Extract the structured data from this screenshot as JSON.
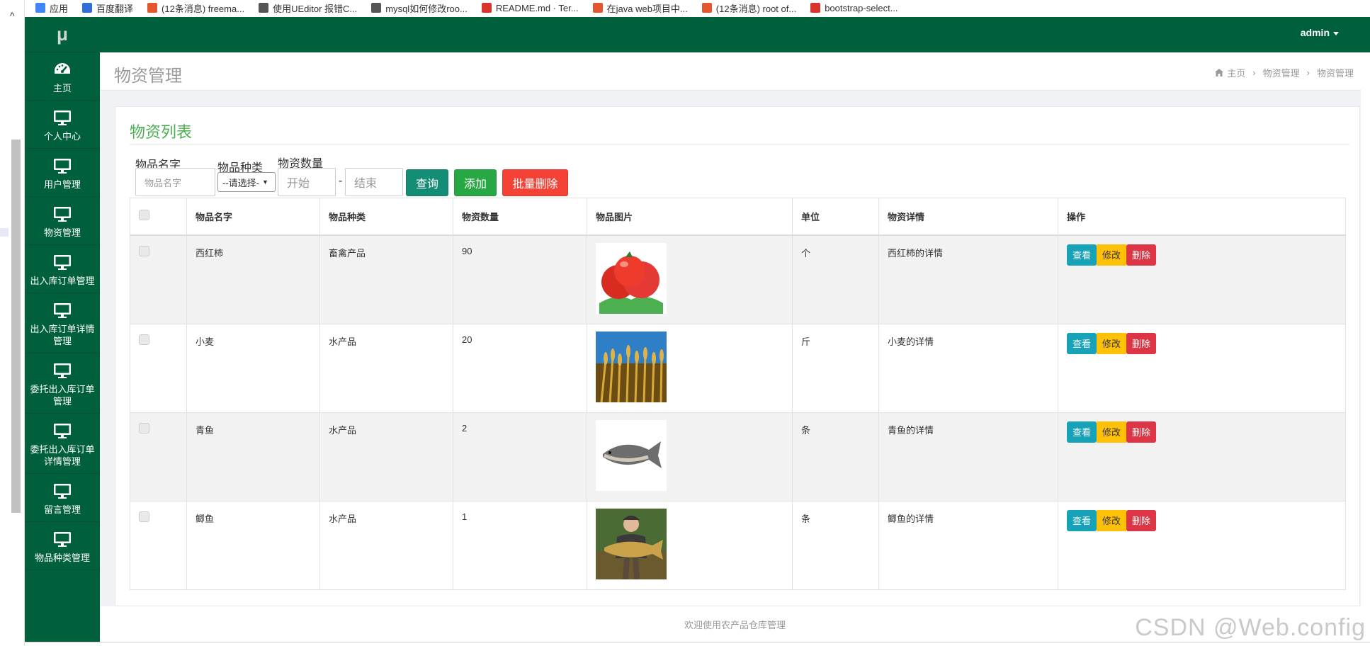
{
  "bookmarks": [
    {
      "label": "应用",
      "color": "#4285f4"
    },
    {
      "label": "百度翻译",
      "color": "#2f6fd6"
    },
    {
      "label": "(12条消息) freema...",
      "color": "#e4572e"
    },
    {
      "label": "使用UEditor 报错C...",
      "color": "#555555"
    },
    {
      "label": "mysql如何修改roo...",
      "color": "#555555"
    },
    {
      "label": "README.md · Ter...",
      "color": "#d9342b"
    },
    {
      "label": "在java web项目中...",
      "color": "#e4572e"
    },
    {
      "label": "(12条消息) root of...",
      "color": "#e4572e"
    },
    {
      "label": "bootstrap-select...",
      "color": "#d9342b"
    }
  ],
  "sidebar": {
    "logo": "μ",
    "items": [
      {
        "label": "主页",
        "icon": "dashboard-icon"
      },
      {
        "label": "个人中心",
        "icon": "monitor-icon"
      },
      {
        "label": "用户管理",
        "icon": "monitor-icon"
      },
      {
        "label": "物资管理",
        "icon": "monitor-icon"
      },
      {
        "label": "出入库订单管理",
        "icon": "monitor-icon"
      },
      {
        "label": "出入库订单详情管理",
        "icon": "monitor-icon"
      },
      {
        "label": "委托出入库订单管理",
        "icon": "monitor-icon"
      },
      {
        "label": "委托出入库订单详情管理",
        "icon": "monitor-icon"
      },
      {
        "label": "留言管理",
        "icon": "monitor-icon"
      },
      {
        "label": "物品种类管理",
        "icon": "monitor-icon"
      }
    ]
  },
  "topbar": {
    "user": "admin"
  },
  "header": {
    "title": "物资管理",
    "breadcrumb": [
      "主页",
      "物资管理",
      "物资管理"
    ]
  },
  "panel": {
    "title": "物资列表"
  },
  "filters": {
    "name_label": "物品名字",
    "name_placeholder": "物品名字",
    "type_label": "物品种类",
    "type_selected": "--请选择-",
    "qty_label": "物资数量",
    "qty_start_placeholder": "开始",
    "qty_dash": "-",
    "qty_end_placeholder": "结束",
    "query_button": "查询",
    "add_button": "添加",
    "batch_delete_button": "批量删除"
  },
  "table": {
    "headers": [
      "物品名字",
      "物品种类",
      "物资数量",
      "物品图片",
      "单位",
      "物资详情",
      "操作"
    ],
    "rows": [
      {
        "name": "西红柿",
        "type": "畜禽产品",
        "qty": "90",
        "image": "tomato",
        "unit": "个",
        "detail": "西红柿的详情"
      },
      {
        "name": "小麦",
        "type": "水产品",
        "qty": "20",
        "image": "wheat",
        "unit": "斤",
        "detail": "小麦的详情"
      },
      {
        "name": "青鱼",
        "type": "水产品",
        "qty": "2",
        "image": "fish",
        "unit": "条",
        "detail": "青鱼的详情"
      },
      {
        "name": "鲫鱼",
        "type": "水产品",
        "qty": "1",
        "image": "carp",
        "unit": "条",
        "detail": "鲫鱼的详情"
      }
    ],
    "actions": {
      "view": "查看",
      "edit": "修改",
      "delete": "删除"
    }
  },
  "footer": {
    "text": "欢迎使用农产品仓库管理"
  },
  "watermark": "CSDN @Web.config",
  "colors": {
    "sidebar": "#00603c",
    "title_green": "#4caf50",
    "query": "#138d75",
    "add": "#28a745",
    "batch_delete": "#dc3545"
  }
}
